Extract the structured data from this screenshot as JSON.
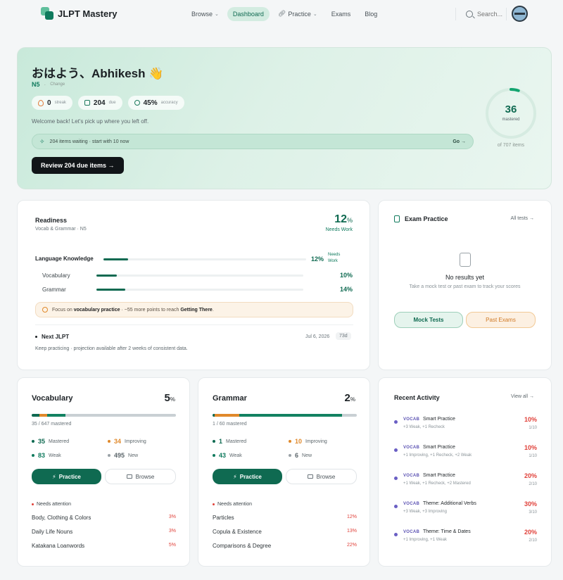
{
  "nav": {
    "logo": "JLPT Mastery",
    "links": [
      {
        "label": "Browse",
        "chev": true
      },
      {
        "label": "Dashboard",
        "active": true
      },
      {
        "label": "Practice",
        "chev": true,
        "icon": "link-icon"
      },
      {
        "label": "Exams"
      },
      {
        "label": "Blog"
      }
    ],
    "search_placeholder": "Search..."
  },
  "hero": {
    "greeting": "おはよう、Abhikesh 👋",
    "level": "N5",
    "sep": "·",
    "change": "Change",
    "pills": [
      {
        "value": "0",
        "label": "streak",
        "icon": "fire-icon"
      },
      {
        "value": "204",
        "label": "due",
        "icon": "calendar-icon"
      },
      {
        "value": "45%",
        "label": "accuracy",
        "icon": "target-icon"
      }
    ],
    "welcome": "Welcome back! Let's pick up where you left off.",
    "waiting": "204 items waiting · start with 10 now",
    "go": "Go →",
    "review_button": "Review 204 due items  →",
    "mastered_count": "36",
    "mastered_label": "mastered",
    "mastered_fraction": 0.051,
    "of_items": "of 707 items"
  },
  "readiness": {
    "title": "Readiness",
    "subtitle": "Vocab & Grammar · N5",
    "pct": "12",
    "pct_unit": "%",
    "status": "Needs Work",
    "rows": [
      {
        "label": "Language Knowledge",
        "pct": "12%",
        "fill": 0.12,
        "note": "Needs Work"
      },
      {
        "label": "Vocabulary",
        "pct": "10%",
        "fill": 0.1
      },
      {
        "label": "Grammar",
        "pct": "14%",
        "fill": 0.14
      }
    ],
    "tip_pre": "Focus on ",
    "tip_bold1": "vocabulary practice",
    "tip_mid": " · ~55 more points to reach ",
    "tip_bold2": "Getting There",
    "tip_end": ".",
    "next_title": "Next JLPT",
    "next_date": "Jul 6, 2026",
    "next_days": "73d",
    "next_note": "Keep practicing · projection available after 2 weeks of consistent data."
  },
  "exam": {
    "title": "Exam Practice",
    "all_tests": "All tests →",
    "empty_title": "No results yet",
    "empty_sub": "Take a mock test or past exam to track your scores",
    "mock": "Mock Tests",
    "past": "Past Exams"
  },
  "vocab": {
    "title": "Vocabulary",
    "pct": "5",
    "pct_unit": "%",
    "mastered_line": "35 / 647 mastered",
    "counts": {
      "mastered": 35,
      "improving": 34,
      "weak": 83,
      "new": 495,
      "total": 647
    },
    "stats": [
      {
        "n": "35",
        "label": "Mastered",
        "color": "#0f6a51"
      },
      {
        "n": "34",
        "label": "Improving",
        "color": "#e0892b"
      },
      {
        "n": "83",
        "label": "Weak",
        "color": "#0f7a5d"
      },
      {
        "n": "495",
        "label": "New",
        "color": "#9aa2a7"
      }
    ],
    "practice": "Practice",
    "browse": "Browse",
    "needs": "Needs attention",
    "attention": [
      {
        "name": "Body, Clothing & Colors",
        "pct": "3%"
      },
      {
        "name": "Daily Life Nouns",
        "pct": "3%"
      },
      {
        "name": "Katakana Loanwords",
        "pct": "5%"
      }
    ]
  },
  "grammar": {
    "title": "Grammar",
    "pct": "2",
    "pct_unit": "%",
    "mastered_line": "1 / 60 mastered",
    "counts": {
      "mastered": 1,
      "improving": 10,
      "weak": 43,
      "new": 6,
      "total": 60
    },
    "stats": [
      {
        "n": "1",
        "label": "Mastered",
        "color": "#0f6a51"
      },
      {
        "n": "10",
        "label": "Improving",
        "color": "#e0892b"
      },
      {
        "n": "43",
        "label": "Weak",
        "color": "#0f7a5d"
      },
      {
        "n": "6",
        "label": "New",
        "color": "#9aa2a7"
      }
    ],
    "practice": "Practice",
    "browse": "Browse",
    "needs": "Needs attention",
    "attention": [
      {
        "name": "Particles",
        "pct": "12%"
      },
      {
        "name": "Copula & Existence",
        "pct": "13%"
      },
      {
        "name": "Comparisons & Degree",
        "pct": "22%"
      }
    ]
  },
  "activity": {
    "title": "Recent Activity",
    "view_all": "View all →",
    "items": [
      {
        "tag": "VOCAB",
        "name": "Smart Practice",
        "detail": "+3 Weak, +1 Recheck",
        "pct": "10%",
        "frac": "1/10"
      },
      {
        "tag": "VOCAB",
        "name": "Smart Practice",
        "detail": "+1 Improving, +1 Recheck, +2 Weak",
        "pct": "10%",
        "frac": "1/10"
      },
      {
        "tag": "VOCAB",
        "name": "Smart Practice",
        "detail": "+1 Weak, +1 Recheck, +2 Mastered",
        "pct": "20%",
        "frac": "2/10"
      },
      {
        "tag": "VOCAB",
        "name": "Theme: Additional Verbs",
        "detail": "+3 Weak, +3 Improving",
        "pct": "30%",
        "frac": "3/10"
      },
      {
        "tag": "VOCAB",
        "name": "Theme: Time & Dates",
        "detail": "+1 Improving, +1 Weak",
        "pct": "20%",
        "frac": "2/10"
      }
    ]
  }
}
